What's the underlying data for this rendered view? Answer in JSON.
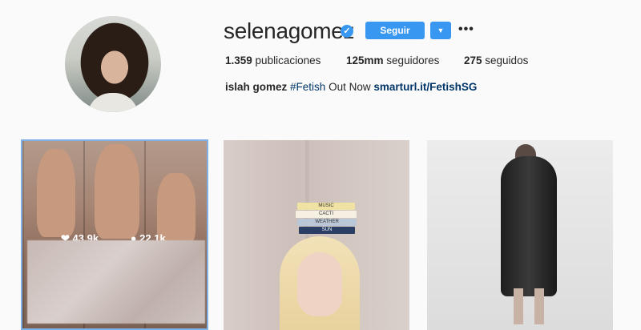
{
  "profile": {
    "username": "selenagomez",
    "verified_icon": "✓",
    "follow_label": "Seguir",
    "dropdown_icon": "▼",
    "more_icon": "•••",
    "stats": {
      "posts_count": "1.359",
      "posts_label": " publicaciones",
      "followers_count": "125mm",
      "followers_label": " seguidores",
      "following_count": "275",
      "following_label": " seguidos"
    },
    "bio": {
      "name": "islah gomez",
      "hashtag": "#Fetish",
      "text": " Out Now ",
      "link": "smarturl.it/FetishSG"
    }
  },
  "posts": [
    {
      "likes": "43,9k",
      "comments": "22,1k"
    },
    {
      "books": [
        "MUSIC",
        "CACTI",
        "WEATHER",
        "SUN"
      ]
    },
    {}
  ],
  "colors": {
    "accent": "#3897f0",
    "link": "#003569",
    "background": "#fafafa"
  }
}
